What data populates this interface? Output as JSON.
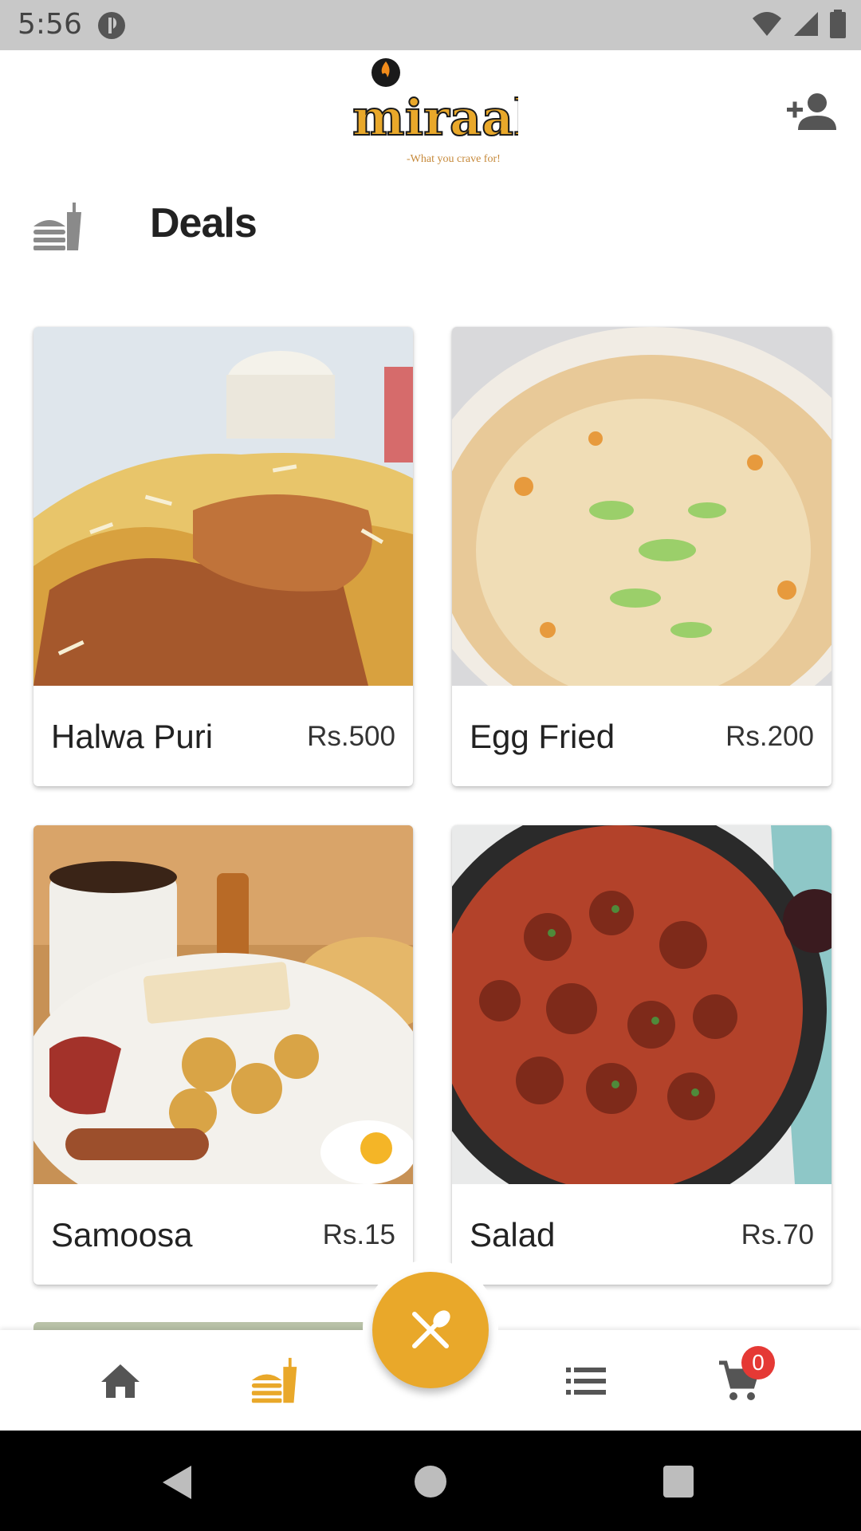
{
  "status_bar": {
    "time": "5:56"
  },
  "header": {
    "logo_text": "miraal",
    "logo_tagline": "-What you crave for!"
  },
  "section": {
    "title": "Deals"
  },
  "deals": [
    {
      "name": "Halwa Puri",
      "price": "Rs.500"
    },
    {
      "name": "Egg Fried",
      "price": "Rs.200"
    },
    {
      "name": "Samoosa",
      "price": "Rs.15"
    },
    {
      "name": "Salad",
      "price": "Rs.70"
    }
  ],
  "bottom_nav": {
    "items": [
      "home-icon",
      "fastfood-icon",
      "restaurant-icon",
      "list-icon",
      "cart-icon"
    ],
    "cart_count": "0"
  },
  "colors": {
    "accent": "#e9a82a",
    "badge": "#e53935",
    "status_bar": "#c8c8c8"
  }
}
